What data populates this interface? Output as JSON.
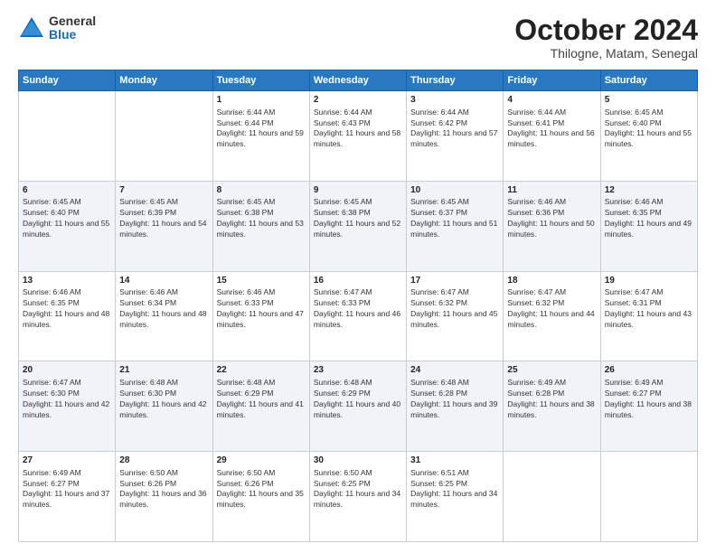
{
  "logo": {
    "general": "General",
    "blue": "Blue"
  },
  "title": {
    "month": "October 2024",
    "location": "Thilogne, Matam, Senegal"
  },
  "headers": [
    "Sunday",
    "Monday",
    "Tuesday",
    "Wednesday",
    "Thursday",
    "Friday",
    "Saturday"
  ],
  "weeks": [
    [
      {
        "day": "",
        "info": ""
      },
      {
        "day": "",
        "info": ""
      },
      {
        "day": "1",
        "info": "Sunrise: 6:44 AM\nSunset: 6:44 PM\nDaylight: 11 hours and 59 minutes."
      },
      {
        "day": "2",
        "info": "Sunrise: 6:44 AM\nSunset: 6:43 PM\nDaylight: 11 hours and 58 minutes."
      },
      {
        "day": "3",
        "info": "Sunrise: 6:44 AM\nSunset: 6:42 PM\nDaylight: 11 hours and 57 minutes."
      },
      {
        "day": "4",
        "info": "Sunrise: 6:44 AM\nSunset: 6:41 PM\nDaylight: 11 hours and 56 minutes."
      },
      {
        "day": "5",
        "info": "Sunrise: 6:45 AM\nSunset: 6:40 PM\nDaylight: 11 hours and 55 minutes."
      }
    ],
    [
      {
        "day": "6",
        "info": "Sunrise: 6:45 AM\nSunset: 6:40 PM\nDaylight: 11 hours and 55 minutes."
      },
      {
        "day": "7",
        "info": "Sunrise: 6:45 AM\nSunset: 6:39 PM\nDaylight: 11 hours and 54 minutes."
      },
      {
        "day": "8",
        "info": "Sunrise: 6:45 AM\nSunset: 6:38 PM\nDaylight: 11 hours and 53 minutes."
      },
      {
        "day": "9",
        "info": "Sunrise: 6:45 AM\nSunset: 6:38 PM\nDaylight: 11 hours and 52 minutes."
      },
      {
        "day": "10",
        "info": "Sunrise: 6:45 AM\nSunset: 6:37 PM\nDaylight: 11 hours and 51 minutes."
      },
      {
        "day": "11",
        "info": "Sunrise: 6:46 AM\nSunset: 6:36 PM\nDaylight: 11 hours and 50 minutes."
      },
      {
        "day": "12",
        "info": "Sunrise: 6:46 AM\nSunset: 6:35 PM\nDaylight: 11 hours and 49 minutes."
      }
    ],
    [
      {
        "day": "13",
        "info": "Sunrise: 6:46 AM\nSunset: 6:35 PM\nDaylight: 11 hours and 48 minutes."
      },
      {
        "day": "14",
        "info": "Sunrise: 6:46 AM\nSunset: 6:34 PM\nDaylight: 11 hours and 48 minutes."
      },
      {
        "day": "15",
        "info": "Sunrise: 6:46 AM\nSunset: 6:33 PM\nDaylight: 11 hours and 47 minutes."
      },
      {
        "day": "16",
        "info": "Sunrise: 6:47 AM\nSunset: 6:33 PM\nDaylight: 11 hours and 46 minutes."
      },
      {
        "day": "17",
        "info": "Sunrise: 6:47 AM\nSunset: 6:32 PM\nDaylight: 11 hours and 45 minutes."
      },
      {
        "day": "18",
        "info": "Sunrise: 6:47 AM\nSunset: 6:32 PM\nDaylight: 11 hours and 44 minutes."
      },
      {
        "day": "19",
        "info": "Sunrise: 6:47 AM\nSunset: 6:31 PM\nDaylight: 11 hours and 43 minutes."
      }
    ],
    [
      {
        "day": "20",
        "info": "Sunrise: 6:47 AM\nSunset: 6:30 PM\nDaylight: 11 hours and 42 minutes."
      },
      {
        "day": "21",
        "info": "Sunrise: 6:48 AM\nSunset: 6:30 PM\nDaylight: 11 hours and 42 minutes."
      },
      {
        "day": "22",
        "info": "Sunrise: 6:48 AM\nSunset: 6:29 PM\nDaylight: 11 hours and 41 minutes."
      },
      {
        "day": "23",
        "info": "Sunrise: 6:48 AM\nSunset: 6:29 PM\nDaylight: 11 hours and 40 minutes."
      },
      {
        "day": "24",
        "info": "Sunrise: 6:48 AM\nSunset: 6:28 PM\nDaylight: 11 hours and 39 minutes."
      },
      {
        "day": "25",
        "info": "Sunrise: 6:49 AM\nSunset: 6:28 PM\nDaylight: 11 hours and 38 minutes."
      },
      {
        "day": "26",
        "info": "Sunrise: 6:49 AM\nSunset: 6:27 PM\nDaylight: 11 hours and 38 minutes."
      }
    ],
    [
      {
        "day": "27",
        "info": "Sunrise: 6:49 AM\nSunset: 6:27 PM\nDaylight: 11 hours and 37 minutes."
      },
      {
        "day": "28",
        "info": "Sunrise: 6:50 AM\nSunset: 6:26 PM\nDaylight: 11 hours and 36 minutes."
      },
      {
        "day": "29",
        "info": "Sunrise: 6:50 AM\nSunset: 6:26 PM\nDaylight: 11 hours and 35 minutes."
      },
      {
        "day": "30",
        "info": "Sunrise: 6:50 AM\nSunset: 6:25 PM\nDaylight: 11 hours and 34 minutes."
      },
      {
        "day": "31",
        "info": "Sunrise: 6:51 AM\nSunset: 6:25 PM\nDaylight: 11 hours and 34 minutes."
      },
      {
        "day": "",
        "info": ""
      },
      {
        "day": "",
        "info": ""
      }
    ]
  ]
}
